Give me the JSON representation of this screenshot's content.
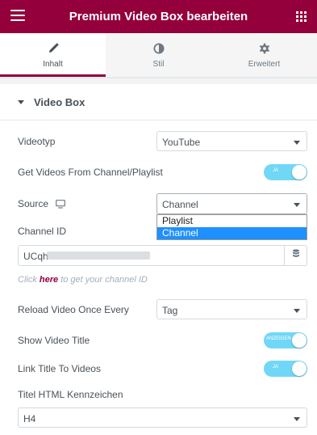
{
  "header": {
    "title": "Premium Video Box bearbeiten",
    "menu_icon": "hamburger-menu-icon",
    "apps_icon": "apps-grid-icon"
  },
  "tabs": [
    {
      "label": "Inhalt",
      "icon": "pencil-icon",
      "active": true
    },
    {
      "label": "Stil",
      "icon": "half-circle-icon",
      "active": false
    },
    {
      "label": "Erweitert",
      "icon": "gear-icon",
      "active": false
    }
  ],
  "section": {
    "title": "Video Box"
  },
  "controls": {
    "video_type": {
      "label": "Videotyp",
      "value": "YouTube"
    },
    "from_channel": {
      "label": "Get Videos From Channel/Playlist",
      "toggle_text": "JA",
      "on": true
    },
    "source": {
      "label": "Source",
      "value": "Channel",
      "options": [
        {
          "label": "Playlist",
          "selected": false
        },
        {
          "label": "Channel",
          "selected": true
        }
      ]
    },
    "channel_id": {
      "label": "Channel ID",
      "value": "UCqh"
    },
    "help": {
      "prefix": "Click ",
      "link": "here",
      "suffix": " to get your channel ID"
    },
    "reload": {
      "label": "Reload Video Once Every",
      "value": "Tag"
    },
    "show_title": {
      "label": "Show Video Title",
      "toggle_text": "ANZEIGEN",
      "on": true
    },
    "link_title": {
      "label": "Link Title To Videos",
      "toggle_text": "JA",
      "on": true
    },
    "html_tag": {
      "label": "Titel HTML Kennzeichen",
      "value": "H4"
    }
  },
  "colors": {
    "brand": "#93003c",
    "toggle_on": "#71d7f7",
    "selected_option": "#1e90ff"
  }
}
